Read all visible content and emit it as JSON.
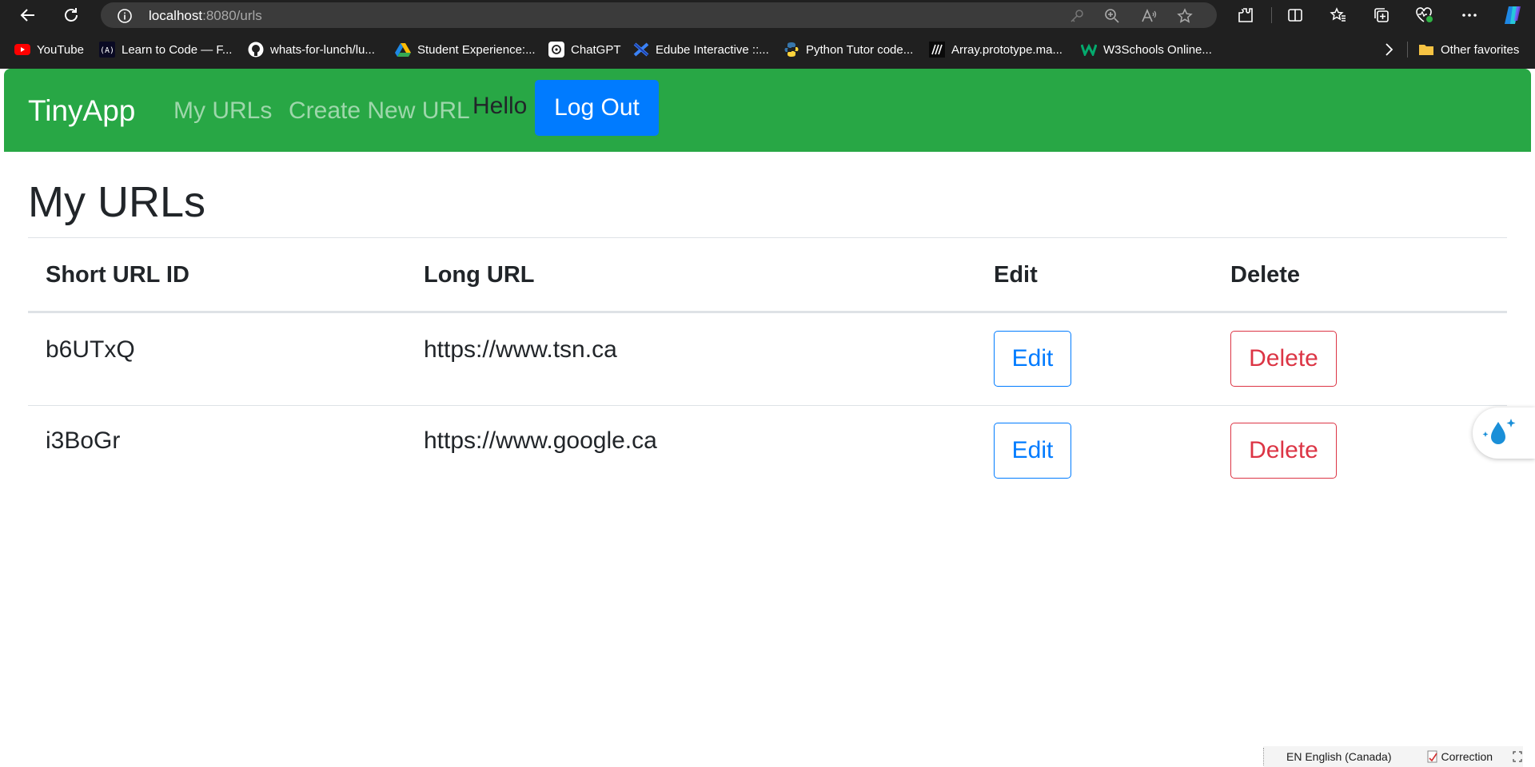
{
  "browser": {
    "url_host": "localhost",
    "url_path": ":8080/urls",
    "bookmarks": [
      {
        "label": "YouTube",
        "icon": "youtube-icon"
      },
      {
        "label": "Learn to Code — F...",
        "icon": "freecodecamp-icon"
      },
      {
        "label": "whats-for-lunch/lu...",
        "icon": "github-icon"
      },
      {
        "label": "Student Experience:...",
        "icon": "google-drive-icon"
      },
      {
        "label": "ChatGPT",
        "icon": "chatgpt-icon"
      },
      {
        "label": "Edube Interactive ::...",
        "icon": "edube-icon"
      },
      {
        "label": "Python Tutor code...",
        "icon": "python-icon"
      },
      {
        "label": "Array.prototype.ma...",
        "icon": "mdn-icon"
      },
      {
        "label": "W3Schools Online...",
        "icon": "w3schools-icon"
      }
    ],
    "other_favorites": "Other favorites"
  },
  "navbar": {
    "brand": "TinyApp",
    "links": [
      "My URLs",
      "Create New URL"
    ],
    "greeting": "Hello",
    "logout_label": "Log Out"
  },
  "main": {
    "title": "My URLs",
    "columns": [
      "Short URL ID",
      "Long URL",
      "Edit",
      "Delete"
    ],
    "rows": [
      {
        "short_id": "b6UTxQ",
        "long_url": "https://www.tsn.ca",
        "edit_label": "Edit",
        "delete_label": "Delete"
      },
      {
        "short_id": "i3BoGr",
        "long_url": "https://www.google.ca",
        "edit_label": "Edit",
        "delete_label": "Delete"
      }
    ]
  },
  "statusbar": {
    "language": "EN English (Canada)",
    "correction": "Correction"
  },
  "colors": {
    "navbar": "#28a745",
    "primary": "#007bff",
    "danger": "#dc3545",
    "chrome": "#202020"
  }
}
